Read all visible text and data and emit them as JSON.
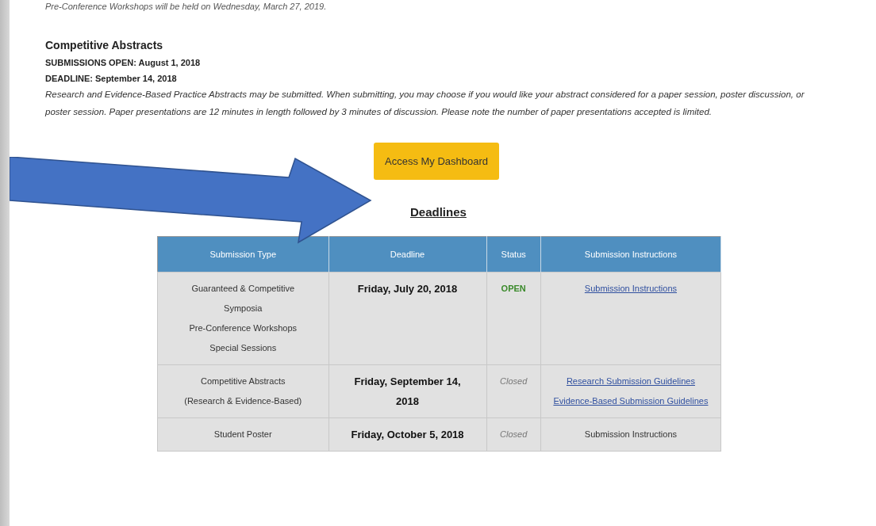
{
  "intro": "Pre-Conference Workshops will be held on Wednesday, March 27, 2019.",
  "section": {
    "title": "Competitive Abstracts",
    "lines": [
      "SUBMISSIONS OPEN: August 1, 2018",
      "DEADLINE: September 14, 2018"
    ],
    "description": "Research and Evidence-Based Practice Abstracts may be submitted. When submitting, you may choose if you would like your abstract considered for a paper session, poster discussion, or poster session.  Paper presentations are 12 minutes in length followed by 3 minutes of discussion. Please note the number of paper presentations accepted is limited."
  },
  "button": "Access My Dashboard",
  "deadlines": {
    "title": "Deadlines",
    "columns": [
      "Submission Type",
      "Deadline",
      "Status",
      "Submission Instructions"
    ],
    "rows": [
      {
        "types": [
          "Guaranteed & Competitive",
          "Symposia",
          "Pre-Conference Workshops",
          "Special Sessions"
        ],
        "deadline": "Friday, July 20, 2018",
        "status": {
          "text": "OPEN",
          "kind": "open"
        },
        "instructions": [
          {
            "text": "Submission Instructions",
            "link": true
          }
        ]
      },
      {
        "types": [
          "Competitive Abstracts",
          "(Research & Evidence-Based)"
        ],
        "deadline": "Friday, September 14, 2018",
        "status": {
          "text": "Closed",
          "kind": "closed"
        },
        "instructions": [
          {
            "text": "Research Submission Guidelines",
            "link": true
          },
          {
            "text": "Evidence-Based Submission Guidelines",
            "link": true
          }
        ]
      },
      {
        "types": [
          "Student Poster"
        ],
        "deadline": "Friday, October 5, 2018",
        "status": {
          "text": "Closed",
          "kind": "closed"
        },
        "instructions": [
          {
            "text": "Submission Instructions",
            "link": false
          }
        ]
      }
    ]
  }
}
